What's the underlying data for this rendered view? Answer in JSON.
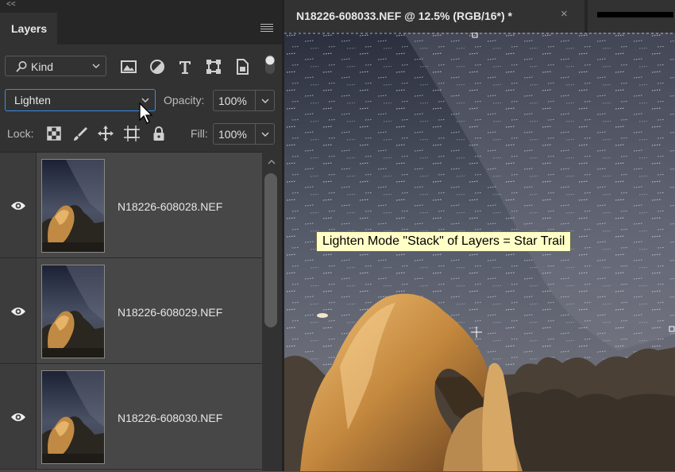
{
  "panel": {
    "collapse_glyph": "<<",
    "tab_label": "Layers",
    "menu_icon": "hamburger-icon",
    "filter": {
      "kind_label": "Kind",
      "icons": [
        "image-filter-icon",
        "adjustment-filter-icon",
        "type-filter-icon",
        "shape-filter-icon",
        "smart-object-filter-icon"
      ]
    },
    "blend_mode": "Lighten",
    "opacity_label": "Opacity:",
    "opacity_value": "100%",
    "lock_label": "Lock:",
    "lock_icons": [
      "lock-transparent-pixels-icon",
      "lock-image-pixels-icon",
      "lock-position-icon",
      "lock-artboard-icon",
      "lock-all-icon"
    ],
    "fill_label": "Fill:",
    "fill_value": "100%",
    "layers": [
      {
        "name": "N18226-608028.NEF",
        "visible": true
      },
      {
        "name": "N18226-608029.NEF",
        "visible": true
      },
      {
        "name": "N18226-608030.NEF",
        "visible": true
      }
    ]
  },
  "document": {
    "tab_title": "N18226-608033.NEF @ 12.5% (RGB/16*) *",
    "close_glyph": "×",
    "tooltip": "Lighten Mode \"Stack\" of Layers = Star Trail"
  },
  "colors": {
    "panel_bg": "#323232",
    "layer_row_bg": "#474747",
    "focus_border": "#3c8ce6",
    "tooltip_bg": "#ffffc6"
  }
}
